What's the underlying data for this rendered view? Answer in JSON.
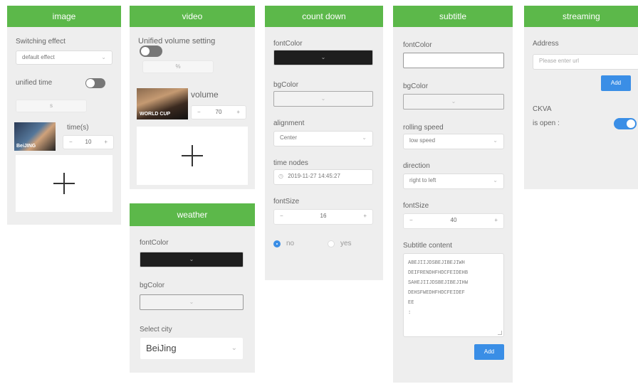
{
  "image_panel": {
    "title": "image",
    "switching_effect_label": "Switching effect",
    "switching_effect_value": "default effect",
    "unified_time_label": "unified time",
    "unified_time_on": false,
    "unified_time_input": "s",
    "thumb_label": "time(s)",
    "thumb_caption": "BeiJING",
    "time_value": "10"
  },
  "video_panel": {
    "title": "video",
    "unified_volume_label": "Unified volume setting",
    "unified_volume_on": false,
    "volume_input": "%",
    "volume_label": "volume",
    "volume_value": "70",
    "thumb_caption": "WORLD CUP"
  },
  "weather_panel": {
    "title": "weather",
    "font_color_label": "fontColor",
    "bg_color_label": "bgColor",
    "select_city_label": "Select city",
    "city_value": "BeiJing"
  },
  "countdown_panel": {
    "title": "count down",
    "font_color_label": "fontColor",
    "bg_color_label": "bgColor",
    "alignment_label": "alignment",
    "alignment_value": "Center",
    "time_nodes_label": "time nodes",
    "time_nodes_value": "2019-11-27 14:45:27",
    "font_size_label": "fontSize",
    "font_size_value": "16",
    "radio_no_label": "no",
    "radio_yes_label": "yes"
  },
  "subtitle_panel": {
    "title": "subtitle",
    "font_color_label": "fontColor",
    "bg_color_label": "bgColor",
    "rolling_speed_label": "rolling speed",
    "rolling_speed_value": "low speed",
    "direction_label": "direction",
    "direction_value": "right to left",
    "font_size_label": "fontSize",
    "font_size_value": "40",
    "content_label": "Subtitle content",
    "content_lines": [
      "ABEJIIJDSBEJIBEJIWH",
      "DEIFRENDHFHDCFEIDEHB",
      "SAHEJIIJDSBEJIBEJIHW",
      "DEHSFWEDHFHDCFEIDEF",
      "EE",
      ":"
    ],
    "add_label": "Add"
  },
  "streaming_panel": {
    "title": "streaming",
    "address_label": "Address",
    "address_placeholder": "Please enter url",
    "add_label": "Add",
    "cwa_label": "CKVA",
    "is_open_label": "is open :",
    "is_open_on": true
  },
  "colors": {
    "header_green": "#5cb84a",
    "panel_bg": "#eeeeee",
    "toggle_on": "#3a8ee6",
    "toggle_off": "#777777"
  }
}
